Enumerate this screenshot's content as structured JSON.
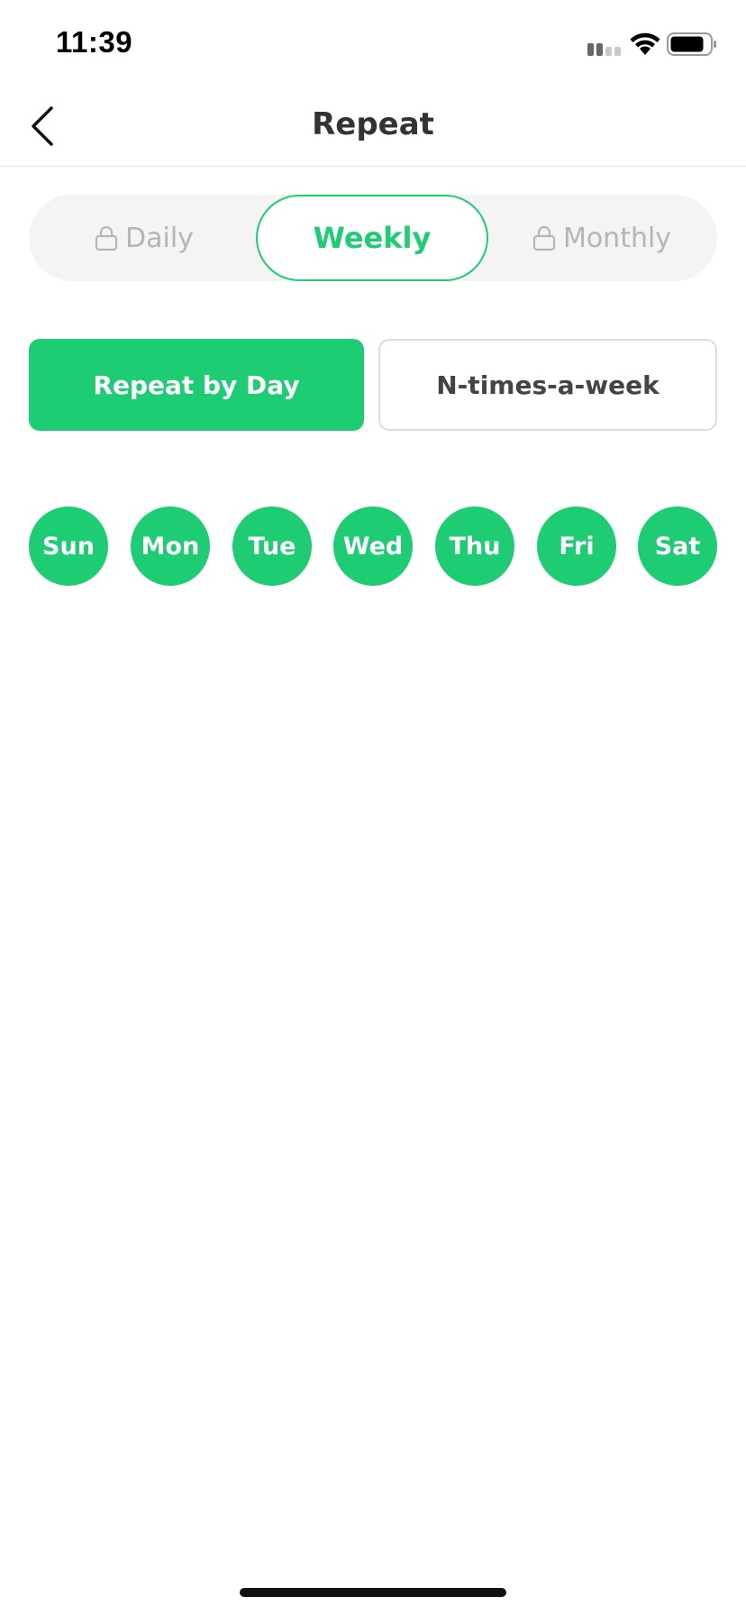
{
  "status_bar": {
    "time": "11:39",
    "icons": [
      "signal-icon",
      "wifi-icon",
      "battery-icon"
    ]
  },
  "nav": {
    "title": "Repeat",
    "back_icon": "chevron-left-icon"
  },
  "frequency_tabs": {
    "items": [
      {
        "label": "Daily",
        "locked": true,
        "selected": false
      },
      {
        "label": "Weekly",
        "locked": false,
        "selected": true
      },
      {
        "label": "Monthly",
        "locked": true,
        "selected": false
      }
    ]
  },
  "repeat_modes": {
    "items": [
      {
        "label": "Repeat by Day",
        "selected": true
      },
      {
        "label": "N-times-a-week",
        "selected": false
      }
    ]
  },
  "days": {
    "items": [
      {
        "label": "Sun",
        "selected": true
      },
      {
        "label": "Mon",
        "selected": true
      },
      {
        "label": "Tue",
        "selected": true
      },
      {
        "label": "Wed",
        "selected": true
      },
      {
        "label": "Thu",
        "selected": true
      },
      {
        "label": "Fri",
        "selected": true
      },
      {
        "label": "Sat",
        "selected": true
      }
    ]
  },
  "colors": {
    "accent": "#1ecd73",
    "segment_bg": "#f4f4f4",
    "disabled_text": "#b5b5b5",
    "title_text": "#333333"
  }
}
